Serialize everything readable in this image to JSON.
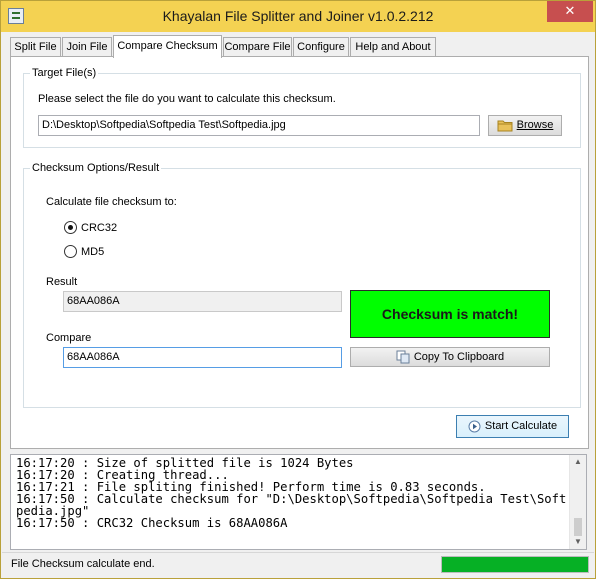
{
  "window": {
    "title": "Khayalan File Splitter and Joiner v1.0.2.212",
    "close_glyph": "✕"
  },
  "tabs": [
    {
      "label": "Split File"
    },
    {
      "label": "Join File"
    },
    {
      "label": "Compare Checksum",
      "active": true
    },
    {
      "label": "Compare File"
    },
    {
      "label": "Configure"
    },
    {
      "label": "Help and About"
    }
  ],
  "target": {
    "group_title": "Target File(s)",
    "instruction": "Please select the file do you want to calculate this checksum.",
    "file_path": "D:\\Desktop\\Softpedia\\Softpedia Test\\Softpedia.jpg",
    "browse_label": "Browse",
    "browse_icon": "folder-icon"
  },
  "options": {
    "group_title": "Checksum Options/Result",
    "calc_label": "Calculate file checksum to:",
    "crc32_label": "CRC32",
    "md5_label": "MD5",
    "selected": "CRC32",
    "result_label": "Result",
    "result_value": "68AA086A",
    "compare_label": "Compare",
    "compare_value": "68AA086A",
    "match_text": "Checksum is match!",
    "match_color": "#00ff00",
    "copy_label": "Copy To Clipboard",
    "copy_icon": "copy-icon"
  },
  "start_label": "Start Calculate",
  "start_icon": "play-icon",
  "log": [
    "16:17:20 : Size of splitted file is 1024 Bytes",
    "16:17:20 : Creating thread...",
    "16:17:21 : File spliting finished! Perform time is 0.83 seconds.",
    "16:17:50 : Calculate checksum for \"D:\\Desktop\\Softpedia\\Softpedia Test\\Softpedia.jpg\"",
    "16:17:50 : CRC32 Checksum is 68AA086A"
  ],
  "status": {
    "text": "File Checksum calculate end.",
    "progress": 1.0,
    "progress_color": "#06b025"
  },
  "colors": {
    "title_bar": "#f4d252",
    "close_button": "#c74f4f"
  }
}
